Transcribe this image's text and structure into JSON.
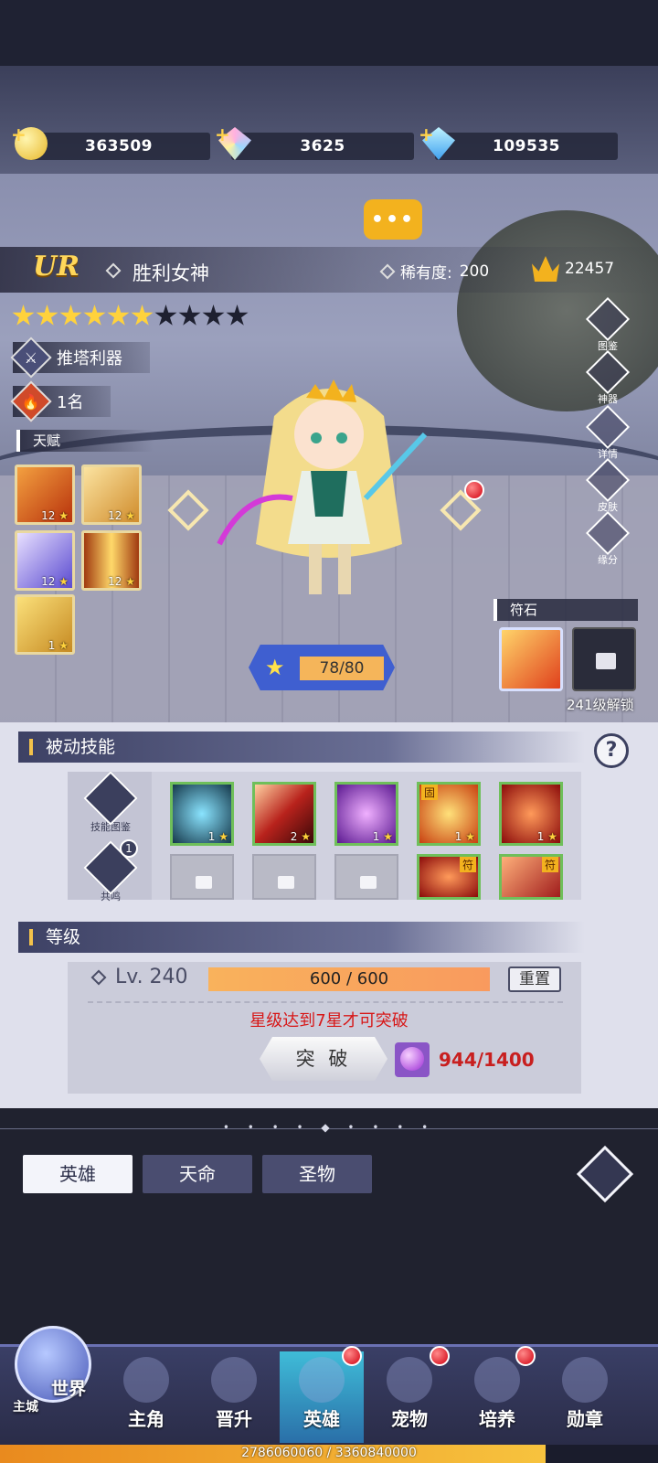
{
  "currencies": [
    {
      "name": "gold-coin-icon",
      "value": "363509"
    },
    {
      "name": "prism-gem-icon",
      "value": "3625"
    },
    {
      "name": "diamond-icon",
      "value": "109535"
    }
  ],
  "hero": {
    "grade": "UR",
    "name": "胜利女神",
    "rarity_label": "稀有度:",
    "rarity_value": "200",
    "power": "22457",
    "stars_total": 10,
    "stars_filled": 6,
    "tag_role": "推塔利器",
    "tag_rank": "1名",
    "talent_label": "天赋",
    "talents": [
      {
        "icon": "flame-claw-icon",
        "level": "12",
        "color": "#e8641c"
      },
      {
        "icon": "golden-wing-icon",
        "level": "12",
        "color": "#e9a640"
      },
      {
        "icon": "purple-slash-icon",
        "level": "12",
        "color": "#6a5ad8"
      },
      {
        "icon": "light-pillar-icon",
        "level": "12",
        "color": "#f2b630"
      },
      {
        "icon": "sword-icon",
        "level": "1",
        "color": "#d6a632"
      }
    ]
  },
  "side_menu": [
    {
      "icon": "codex-icon",
      "label": "图鉴"
    },
    {
      "icon": "artifact-icon",
      "label": "神器"
    },
    {
      "icon": "magnifier-icon",
      "label": "详情"
    },
    {
      "icon": "skin-icon",
      "label": "皮肤"
    },
    {
      "icon": "heart-icon",
      "label": "缘分"
    }
  ],
  "rune": {
    "label": "符石",
    "unlock_text": "241级解锁"
  },
  "exp": {
    "value": "78/80"
  },
  "passive": {
    "title": "被动技能",
    "help": "?",
    "side_buttons": [
      {
        "icon": "skill-book-icon",
        "label": "技能图鉴"
      },
      {
        "icon": "resonance-icon",
        "label": "共鸣",
        "badge": "1"
      }
    ],
    "skills": [
      {
        "icon": "ice-shard-icon",
        "level": "1",
        "color": "#2c6e80"
      },
      {
        "icon": "red-claw-icon",
        "level": "2",
        "color": "#b8221c"
      },
      {
        "icon": "violet-burst-icon",
        "level": "1",
        "color": "#7a2ab8"
      },
      {
        "icon": "fire-rune-icon",
        "level": "1",
        "color": "#e0601c",
        "tag": "固"
      },
      {
        "icon": "demon-mask-icon",
        "level": "1",
        "color": "#c41818"
      }
    ],
    "bottom_row_tags": [
      "符",
      "符"
    ]
  },
  "level": {
    "title": "等级",
    "lv_text": "Lv. 240",
    "bar_text": "600 / 600",
    "reset": "重置",
    "warning": "星级达到7星才可突破",
    "break_button": "突 破",
    "break_cost": "944/1400"
  },
  "tabs": [
    {
      "label": "英雄",
      "active": true
    },
    {
      "label": "天命",
      "active": false
    },
    {
      "label": "圣物",
      "active": false
    }
  ],
  "nav": {
    "world": "世界",
    "city": "主城",
    "items": [
      {
        "label": "主角",
        "icon": "warrior-icon",
        "dot": false
      },
      {
        "label": "晋升",
        "icon": "book-icon",
        "dot": false
      },
      {
        "label": "英雄",
        "icon": "helmet-icon",
        "dot": true,
        "active": true
      },
      {
        "label": "宠物",
        "icon": "pet-icon",
        "dot": true
      },
      {
        "label": "培养",
        "icon": "cultivate-icon",
        "dot": true
      },
      {
        "label": "勋章",
        "icon": "medal-icon",
        "dot": false
      }
    ]
  },
  "account_exp": {
    "text": "2786060060 / 3360840000",
    "fraction": 0.829
  }
}
